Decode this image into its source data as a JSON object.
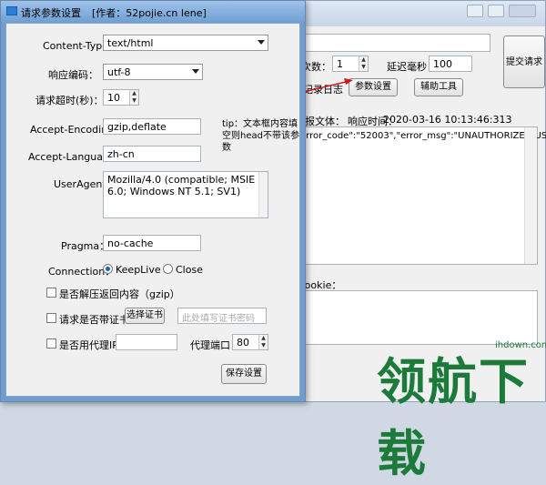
{
  "main_window": {
    "retry_label": "次数：",
    "retry_value": "1",
    "delay_label": "延迟毫秒：",
    "delay_value": "100",
    "submit_label": "提交请求",
    "log_label": "记录日志",
    "params_button": "参数设置",
    "tools_button": "辅助工具",
    "response_label": "报文体：",
    "response_time_label": "响应时间：",
    "response_time_value": "2020-03-16 10:13:46:313",
    "response_body": "error_code\":\"52003\",\"error_msg\":\"UNAUTHORIZED USER\"}",
    "cookie_label": "Cookie："
  },
  "dialog": {
    "title": "请求参数设置",
    "author": "[作者：52pojie.cn lene]",
    "content_type_label": "Content-Type：",
    "content_type_value": "text/html",
    "encoding_label": "响应编码：",
    "encoding_value": "utf-8",
    "timeout_label": "请求超时(秒)：",
    "timeout_value": "10",
    "accept_encoding_label": "Accept-Encoding：",
    "accept_encoding_value": "gzip,deflate",
    "tip_text": "tip：文本框内容填空则head不带该参数",
    "accept_language_label": "Accept-Language：",
    "accept_language_value": "zh-cn",
    "useragent_label": "UserAgent：",
    "useragent_value": "Mozilla/4.0 (compatible; MSIE 6.0; Windows NT 5.1; SV1)",
    "pragma_label": "Pragma：",
    "pragma_value": "no-cache",
    "connection_label": "Connection：",
    "keepalive_label": "KeepLive",
    "close_label": "Close",
    "gzip_label": "是否解压返回内容（gzip）",
    "cert_label": "请求是否带证书：",
    "choose_cert_button": "选择证书",
    "cert_placeholder": "此处填写证书密码",
    "proxy_label": "是否用代理IP：",
    "proxy_port_label": "代理端口：",
    "proxy_port_value": "80",
    "save_button": "保存设置"
  },
  "watermark": {
    "text": "领航下载",
    "url": "ihdown.com"
  }
}
